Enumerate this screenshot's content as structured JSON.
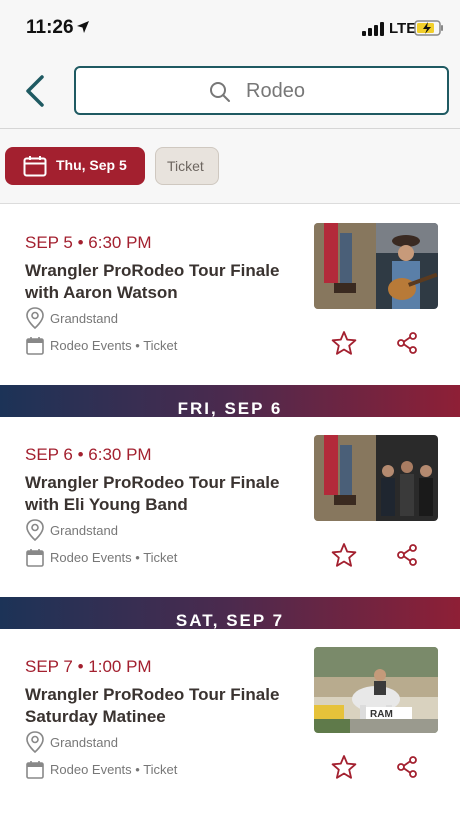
{
  "status_bar": {
    "time": "11:26",
    "network": "LTE"
  },
  "search": {
    "query": "Rodeo"
  },
  "filters": {
    "date_chip": "Thu, Sep 5",
    "ticket_chip": "Ticket"
  },
  "colors": {
    "accent": "#a3202f",
    "teal": "#1f5a62",
    "band_start": "#1c3357",
    "band_end": "#8e1f36"
  },
  "day_headers": [
    "FRI, SEP 6",
    "SAT, SEP 7"
  ],
  "events": [
    {
      "date_time": "SEP 5 • 6:30 PM",
      "title": "Wrangler ProRodeo Tour Finale with Aaron Watson",
      "venue": "Grandstand",
      "category": "Rodeo Events • Ticket",
      "image": "rodeo-and-guitarist-photo"
    },
    {
      "date_time": "SEP 6 • 6:30 PM",
      "title": "Wrangler ProRodeo Tour Finale with Eli Young Band",
      "venue": "Grandstand",
      "category": "Rodeo Events • Ticket",
      "image": "rodeo-and-band-photo"
    },
    {
      "date_time": "SEP 7 • 1:00 PM",
      "title": "Wrangler ProRodeo Tour Finale Saturday Matinee",
      "venue": "Grandstand",
      "category": "Rodeo Events • Ticket",
      "image": "bull-riding-photo",
      "image_text": "RAM"
    }
  ]
}
